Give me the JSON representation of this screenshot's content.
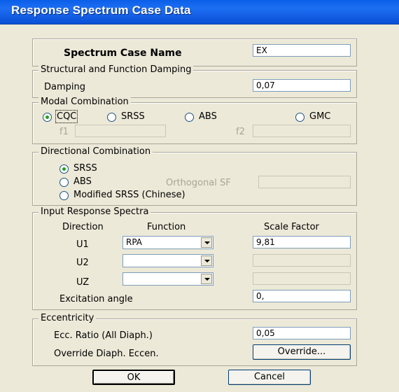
{
  "window": {
    "title": "Response Spectrum Case Data"
  },
  "case_name": {
    "label": "Spectrum Case Name",
    "value": "EX"
  },
  "damping_group": {
    "title": "Structural and Function Damping",
    "label": "Damping",
    "value": "0,07"
  },
  "modal_group": {
    "title": "Modal Combination",
    "options": [
      "CQC",
      "SRSS",
      "ABS",
      "GMC"
    ],
    "selected": "CQC",
    "f1_label": "f1",
    "f2_label": "f2",
    "f1_value": "",
    "f2_value": ""
  },
  "directional_group": {
    "title": "Directional Combination",
    "options": [
      "SRSS",
      "ABS",
      "Modified SRSS (Chinese)"
    ],
    "selected": "SRSS",
    "orthogonal_label": "Orthogonal SF",
    "orthogonal_value": ""
  },
  "input_group": {
    "title": "Input Response Spectra",
    "col_direction": "Direction",
    "col_function": "Function",
    "col_scale": "Scale Factor",
    "rows": [
      {
        "direction": "U1",
        "function": "RPA",
        "scale": "9,81"
      },
      {
        "direction": "U2",
        "function": "",
        "scale": ""
      },
      {
        "direction": "UZ",
        "function": "",
        "scale": ""
      }
    ],
    "excitation_label": "Excitation  angle",
    "excitation_value": "0,"
  },
  "eccentricity_group": {
    "title": "Eccentricity",
    "ratio_label": "Ecc. Ratio (All Diaph.)",
    "ratio_value": "0,05",
    "override_label": "Override Diaph. Eccen.",
    "override_button": "Override..."
  },
  "buttons": {
    "ok": "OK",
    "cancel": "Cancel"
  },
  "colors": {
    "titlebar": "#0a5ee8",
    "dialog_bg": "#ece9d8",
    "radio_dot": "#21a121"
  }
}
